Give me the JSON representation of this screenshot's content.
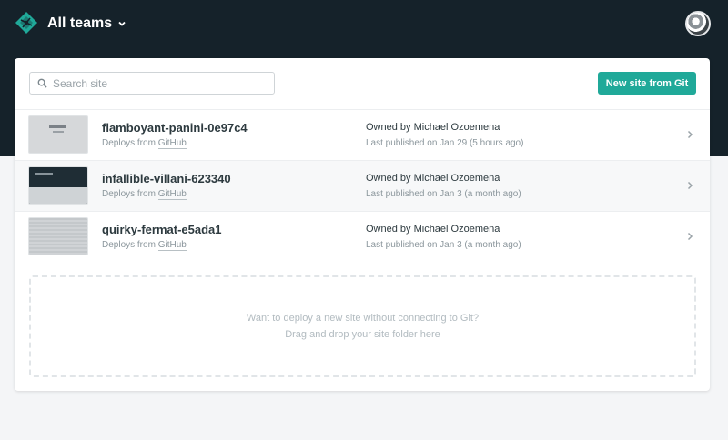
{
  "header": {
    "team_label": "All teams",
    "colors": {
      "background": "#15222a",
      "logo": "#20a999"
    }
  },
  "toolbar": {
    "search_placeholder": "Search site",
    "new_site_label": "New site from Git",
    "accent": "#20a999"
  },
  "sites": [
    {
      "name": "flamboyant-panini-0e97c4",
      "deploys_prefix": "Deploys from ",
      "deploys_source": "GitHub",
      "owner": "Owned by Michael Ozoemena",
      "published": "Last published on Jan 29 (5 hours ago)"
    },
    {
      "name": "infallible-villani-623340",
      "deploys_prefix": "Deploys from ",
      "deploys_source": "GitHub",
      "owner": "Owned by Michael Ozoemena",
      "published": "Last published on Jan 3 (a month ago)"
    },
    {
      "name": "quirky-fermat-e5ada1",
      "deploys_prefix": "Deploys from ",
      "deploys_source": "GitHub",
      "owner": "Owned by Michael Ozoemena",
      "published": "Last published on Jan 3 (a month ago)"
    }
  ],
  "dropzone": {
    "line1": "Want to deploy a new site without connecting to Git?",
    "line2": "Drag and drop your site folder here"
  },
  "icons": {
    "logo": "netlify-logo-icon",
    "team_chevron": "chevron-down-icon",
    "search": "search-icon",
    "row_arrow": "chevron-right-icon"
  }
}
